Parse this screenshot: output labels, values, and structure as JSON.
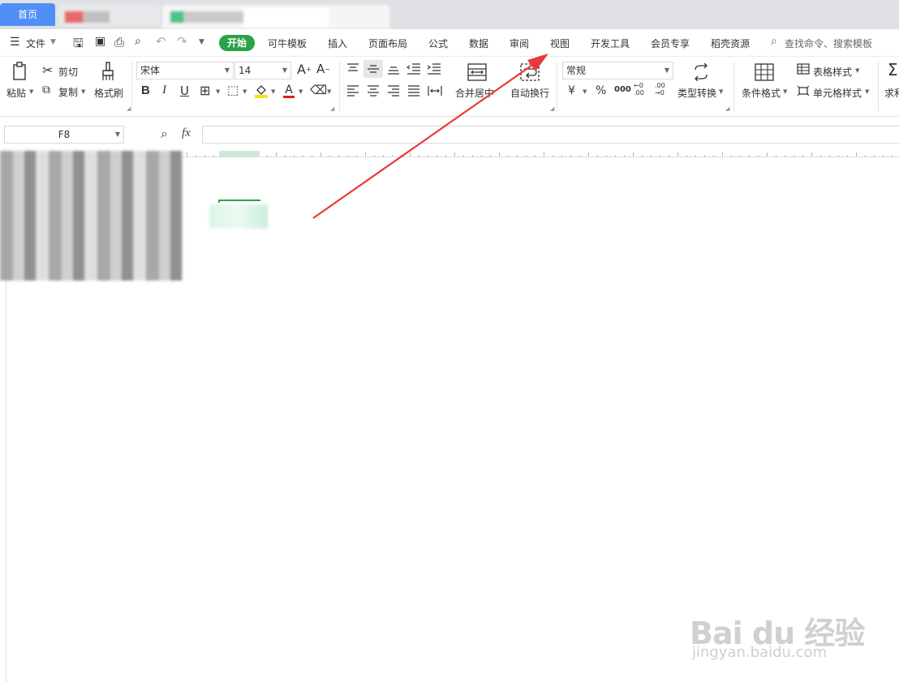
{
  "tabs": {
    "home": "首页"
  },
  "menu": {
    "file": "文件",
    "items": [
      "开始",
      "可牛模板",
      "插入",
      "页面布局",
      "公式",
      "数据",
      "审阅",
      "视图",
      "开发工具",
      "会员专享",
      "稻壳资源"
    ],
    "search_placeholder": "查找命令、搜索模板"
  },
  "ribbon": {
    "paste": "粘贴",
    "cut": "剪切",
    "copy": "复制",
    "format_painter": "格式刷",
    "font_name": "宋体",
    "font_size": "14",
    "merge_center": "合并居中",
    "wrap_text": "自动换行",
    "number_format": "常规",
    "currency": "¥",
    "percent": "%",
    "thousands": "000",
    "type_convert": "类型转换",
    "conditional_format": "条件格式",
    "table_style": "表格样式",
    "cell_style": "单元格样式",
    "sum": "求和"
  },
  "formula": {
    "cell_ref": "F8",
    "fx": "fx"
  },
  "watermark": {
    "brand": "Bai du 经验",
    "url": "jingyan.baidu.com"
  },
  "colors": {
    "accent": "#2ba245",
    "home_tab": "#4f8ff7",
    "arrow": "#e83a3a"
  }
}
